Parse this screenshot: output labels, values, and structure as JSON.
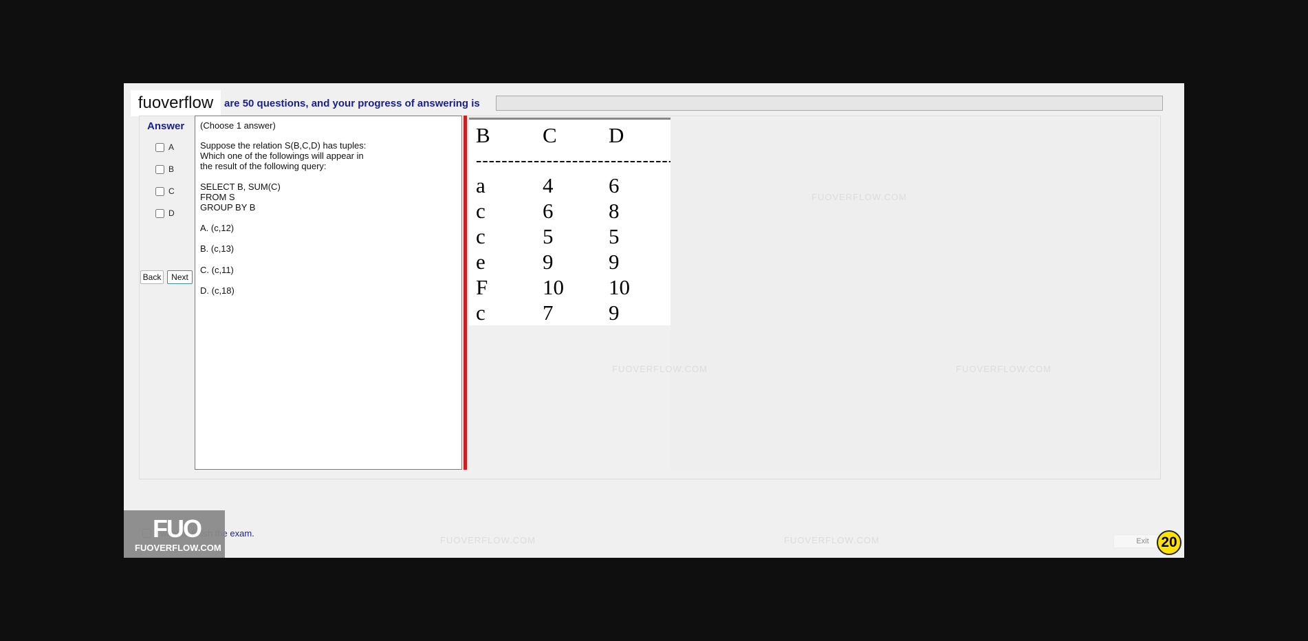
{
  "brand": {
    "name": "fuoverflow"
  },
  "header": {
    "progress_text": "are 50 questions, and your progress of answering is",
    "progress_fraction": 0
  },
  "answer_panel": {
    "title": "Answer",
    "options": [
      "A",
      "B",
      "C",
      "D"
    ],
    "back_label": "Back",
    "next_label": "Next"
  },
  "question": {
    "instruction": "(Choose 1 answer)",
    "lines": [
      "Suppose the relation S(B,C,D) has tuples:",
      "Which one of the followings will appear in",
      "the result of the following query:"
    ],
    "query": [
      "SELECT B, SUM(C)",
      "FROM S",
      "GROUP BY B"
    ],
    "choices": [
      "A.  (c,12)",
      "B.  (c,13)",
      "C.  (c,11)",
      "D.  (c,18)"
    ]
  },
  "relation": {
    "headers": [
      "B",
      "C",
      "D"
    ],
    "separator": "----------------------------------",
    "rows": [
      [
        "a",
        "4",
        "6"
      ],
      [
        "c",
        "6",
        "8"
      ],
      [
        "c",
        "5",
        "5"
      ],
      [
        "e",
        "9",
        "9"
      ],
      [
        "F",
        "10",
        "10"
      ],
      [
        "c",
        "7",
        "9"
      ]
    ]
  },
  "watermarks": [
    "FUOVERFLOW.COM"
  ],
  "footer": {
    "finish_label": "I want to finish the exam.",
    "logo_big": "FUO",
    "logo_small": "FUOVERFLOW.COM",
    "exit_label": "Exit",
    "timer": "20"
  }
}
